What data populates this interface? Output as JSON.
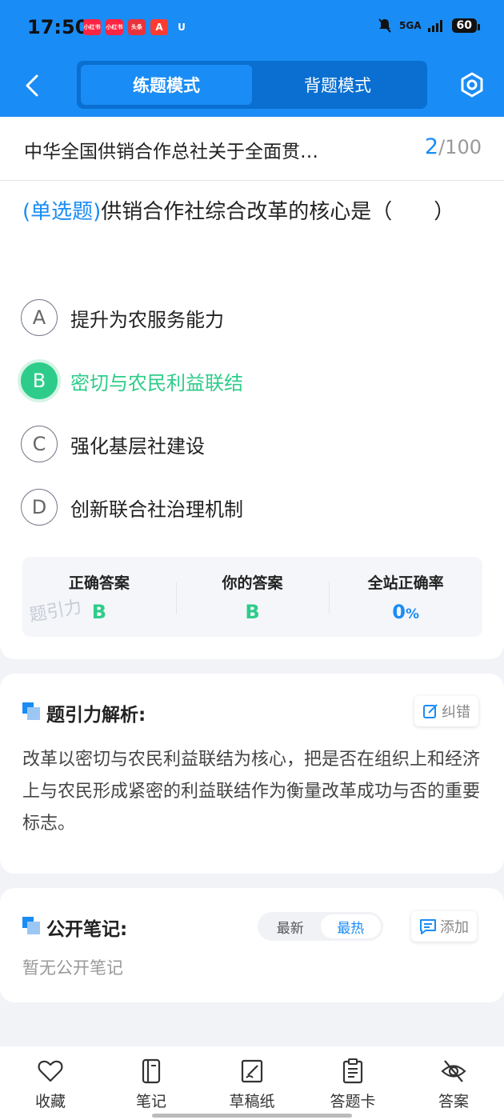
{
  "status_bar": {
    "time": "17:50",
    "apps": [
      {
        "label": "小红书",
        "color": "#ff2442"
      },
      {
        "label": "小红书",
        "color": "#ff2442"
      },
      {
        "label": "头条",
        "color": "#e8323c"
      },
      {
        "label": "A",
        "color": "#ff3b30"
      },
      {
        "label": "U",
        "color": "#1a8cf5"
      }
    ],
    "network": "5GA",
    "battery": "60"
  },
  "header": {
    "tabs": [
      {
        "label": "练题模式",
        "active": true
      },
      {
        "label": "背题模式",
        "active": false
      }
    ],
    "accent": "#1a8cf5"
  },
  "question": {
    "title": "中华全国供销合作总社关于全面贯…",
    "current": "2",
    "total": "/100",
    "type": "(单选题)",
    "text": "供销合作社综合改革的核心是（　　）",
    "options": [
      {
        "letter": "A",
        "text": "提升为农服务能力",
        "state": "normal"
      },
      {
        "letter": "B",
        "text": "密切与农民利益联结",
        "state": "correct"
      },
      {
        "letter": "C",
        "text": "强化基层社建设",
        "state": "normal"
      },
      {
        "letter": "D",
        "text": "创新联合社治理机制",
        "state": "normal"
      }
    ],
    "answer_panel": {
      "correct_label": "正确答案",
      "correct_value": "B",
      "yours_label": "你的答案",
      "yours_value": "B",
      "rate_label": "全站正确率",
      "rate_value": "0",
      "rate_unit": "%",
      "watermark": "题引力"
    }
  },
  "analysis": {
    "title": "题引力解析:",
    "report_label": "纠错",
    "text": "改革以密切与农民利益联结为核心，把是否在组织上和经济上与农民形成紧密的利益联结作为衡量改革成功与否的重要标志。"
  },
  "notes": {
    "title": "公开笔记:",
    "sort_options": [
      {
        "label": "最新",
        "active": false
      },
      {
        "label": "最热",
        "active": true
      }
    ],
    "add_label": "添加",
    "empty_text": "暂无公开笔记"
  },
  "bottom_nav": [
    {
      "label": "收藏",
      "icon": "heart-icon"
    },
    {
      "label": "笔记",
      "icon": "notebook-icon"
    },
    {
      "label": "草稿纸",
      "icon": "draft-icon"
    },
    {
      "label": "答题卡",
      "icon": "answer-card-icon"
    },
    {
      "label": "答案",
      "icon": "eye-off-icon"
    }
  ]
}
